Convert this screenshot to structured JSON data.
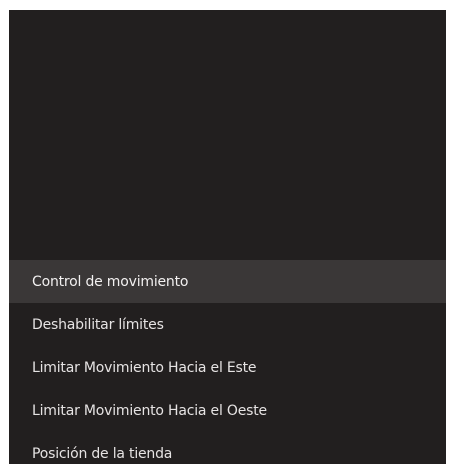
{
  "menu": {
    "items": [
      {
        "label": "Control de movimiento",
        "selected": true
      },
      {
        "label": "Deshabilitar límites",
        "selected": false
      },
      {
        "label": "Limitar Movimiento Hacia el Este",
        "selected": false
      },
      {
        "label": "Limitar Movimiento Hacia el Oeste",
        "selected": false
      },
      {
        "label": "Posición de la tienda",
        "selected": false
      }
    ]
  },
  "colors": {
    "background": "#221f1f",
    "selected_background": "#3a3737",
    "text": "#e6e3e3"
  }
}
